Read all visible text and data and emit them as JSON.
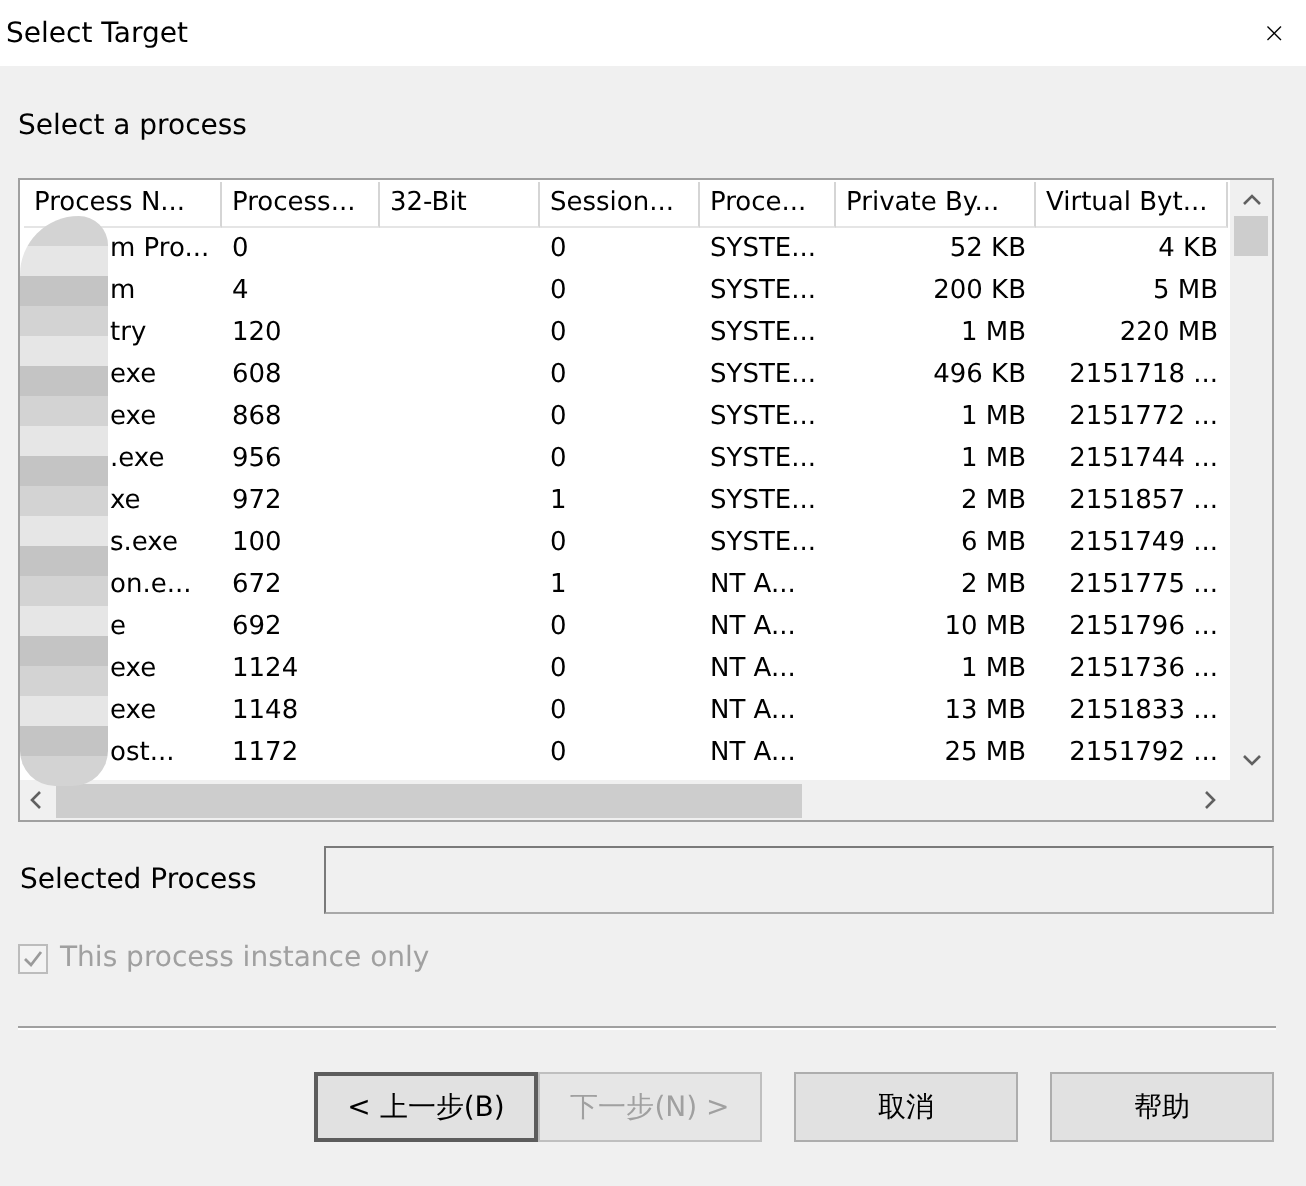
{
  "window": {
    "title": "Select Target",
    "close": "×"
  },
  "prompt": "Select a process",
  "table": {
    "columns": [
      "Process N...",
      "Process...",
      "32-Bit",
      "Session...",
      "Proce...",
      "Private By...",
      "Virtual Byt..."
    ],
    "rows": [
      [
        "m Pro...",
        "0",
        "",
        "0",
        "SYSTE...",
        "52 KB",
        "4 KB"
      ],
      [
        "m",
        "4",
        "",
        "0",
        "SYSTE...",
        "200 KB",
        "5 MB"
      ],
      [
        "try",
        "120",
        "",
        "0",
        "SYSTE...",
        "1 MB",
        "220 MB"
      ],
      [
        "exe",
        "608",
        "",
        "0",
        "SYSTE...",
        "496 KB",
        "2151718 ..."
      ],
      [
        "exe",
        "868",
        "",
        "0",
        "SYSTE...",
        "1 MB",
        "2151772 ..."
      ],
      [
        ".exe",
        "956",
        "",
        "0",
        "SYSTE...",
        "1 MB",
        "2151744 ..."
      ],
      [
        "xe",
        "972",
        "",
        "1",
        "SYSTE...",
        "2 MB",
        "2151857 ..."
      ],
      [
        "s.exe",
        "100",
        "",
        "0",
        "SYSTE...",
        "6 MB",
        "2151749 ..."
      ],
      [
        "on.e...",
        "672",
        "",
        "1",
        "NT A...",
        "2 MB",
        "2151775 ..."
      ],
      [
        "e",
        "692",
        "",
        "0",
        "NT A...",
        "10 MB",
        "2151796 ..."
      ],
      [
        "exe",
        "1124",
        "",
        "0",
        "NT A...",
        "1 MB",
        "2151736 ..."
      ],
      [
        "exe",
        "1148",
        "",
        "0",
        "NT A...",
        "13 MB",
        "2151833 ..."
      ],
      [
        "ost...",
        "1172",
        "",
        "0",
        "NT A...",
        "25 MB",
        "2151792 ..."
      ]
    ]
  },
  "selected_process": {
    "label": "Selected Process"
  },
  "instance_only": {
    "label": "This process instance only",
    "checked": true,
    "disabled": true
  },
  "buttons": [
    {
      "label": "< 上一步(B)",
      "disabled": false
    },
    {
      "label": "下一步(N) >",
      "disabled": true
    },
    {
      "label": "取消",
      "disabled": false
    },
    {
      "label": "帮助",
      "disabled": false
    }
  ]
}
